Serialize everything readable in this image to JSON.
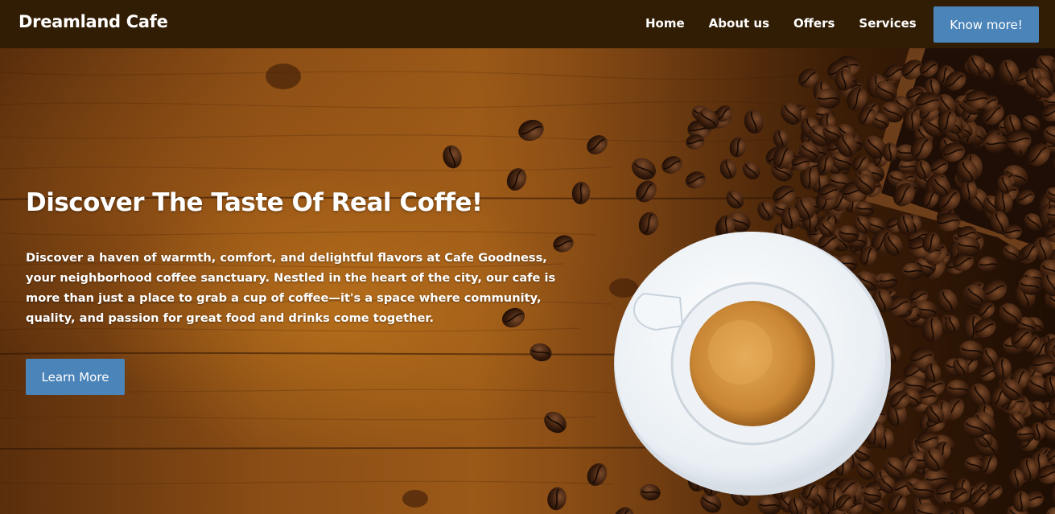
{
  "brand": {
    "name": "Dreamland Cafe"
  },
  "nav": {
    "items": [
      {
        "label": "Home"
      },
      {
        "label": "About us"
      },
      {
        "label": "Offers"
      },
      {
        "label": "Services"
      }
    ],
    "cta_label": "Know more!"
  },
  "hero": {
    "title": "Discover The Taste Of Real Coffe!",
    "description": "Discover a haven of warmth, comfort, and delightful flavors at Cafe Goodness, your neighborhood coffee sanctuary. Nestled in the heart of the city, our cafe is more than just a place to grab a cup of coffee—it's a space where community, quality, and passion for great food and drinks come together.",
    "cta_label": "Learn More"
  },
  "colors": {
    "navbar_bg": "#311d04",
    "button_bg": "#4a84b8",
    "text": "#ffffff"
  }
}
